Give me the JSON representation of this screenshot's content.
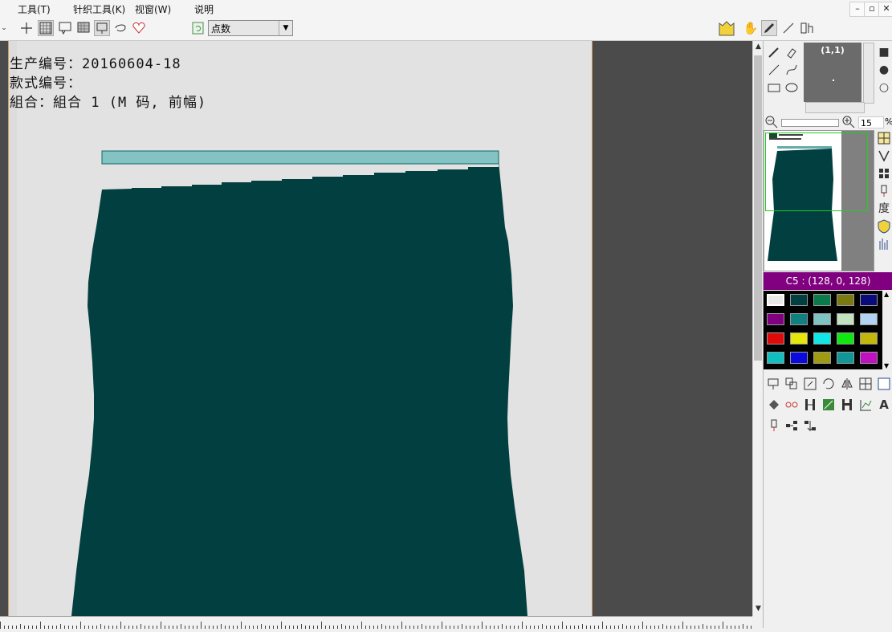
{
  "menubar": {
    "items": [
      "工具(T)",
      "针织工具(K)",
      "视窗(W)",
      "说明"
    ],
    "window_buttons": {
      "minimize": "–",
      "restore": "▫",
      "close": "✕"
    }
  },
  "toolbar": {
    "mode_select": {
      "value": "点数"
    },
    "left_icons": [
      "cross-icon",
      "grid-icon",
      "select-icon",
      "fill-grid-icon",
      "rect-select-icon",
      "lasso-icon",
      "heart-icon"
    ],
    "right_icons": [
      "palm-icon",
      "hand-icon",
      "brush-icon",
      "line-icon",
      "figure-icon"
    ]
  },
  "canvas": {
    "production_label": "生产编号：",
    "production_value": "20160604-18",
    "style_label": "款式编号：",
    "combo_label": "組合：",
    "combo_value": "組合 1 (M 码, 前幅)",
    "colors": {
      "garment": "#023f40",
      "band": "#83c3c3",
      "paper": "#e2e2e2",
      "background": "#4b4b4b"
    }
  },
  "right_panel": {
    "preview_coord": "(1,1)",
    "zoom_value": "15",
    "zoom_unit": "%",
    "color_info": "C5 : (128, 0, 128)",
    "side_char": "度",
    "palette": [
      [
        "#e9e9e9",
        "#023f40",
        "#0a7a4a",
        "#7a7a10",
        "#0a0a7a"
      ],
      [
        "#800080",
        "#118080",
        "#7fc3c3",
        "#c2e2c2",
        "#b2d4f2"
      ],
      [
        "#e00a0a",
        "#e6e60a",
        "#10e6e6",
        "#10e610",
        "#c3b80a"
      ],
      [
        "#10c0c0",
        "#0a0ae0",
        "#a09a10",
        "#109898",
        "#c010c0"
      ]
    ]
  }
}
